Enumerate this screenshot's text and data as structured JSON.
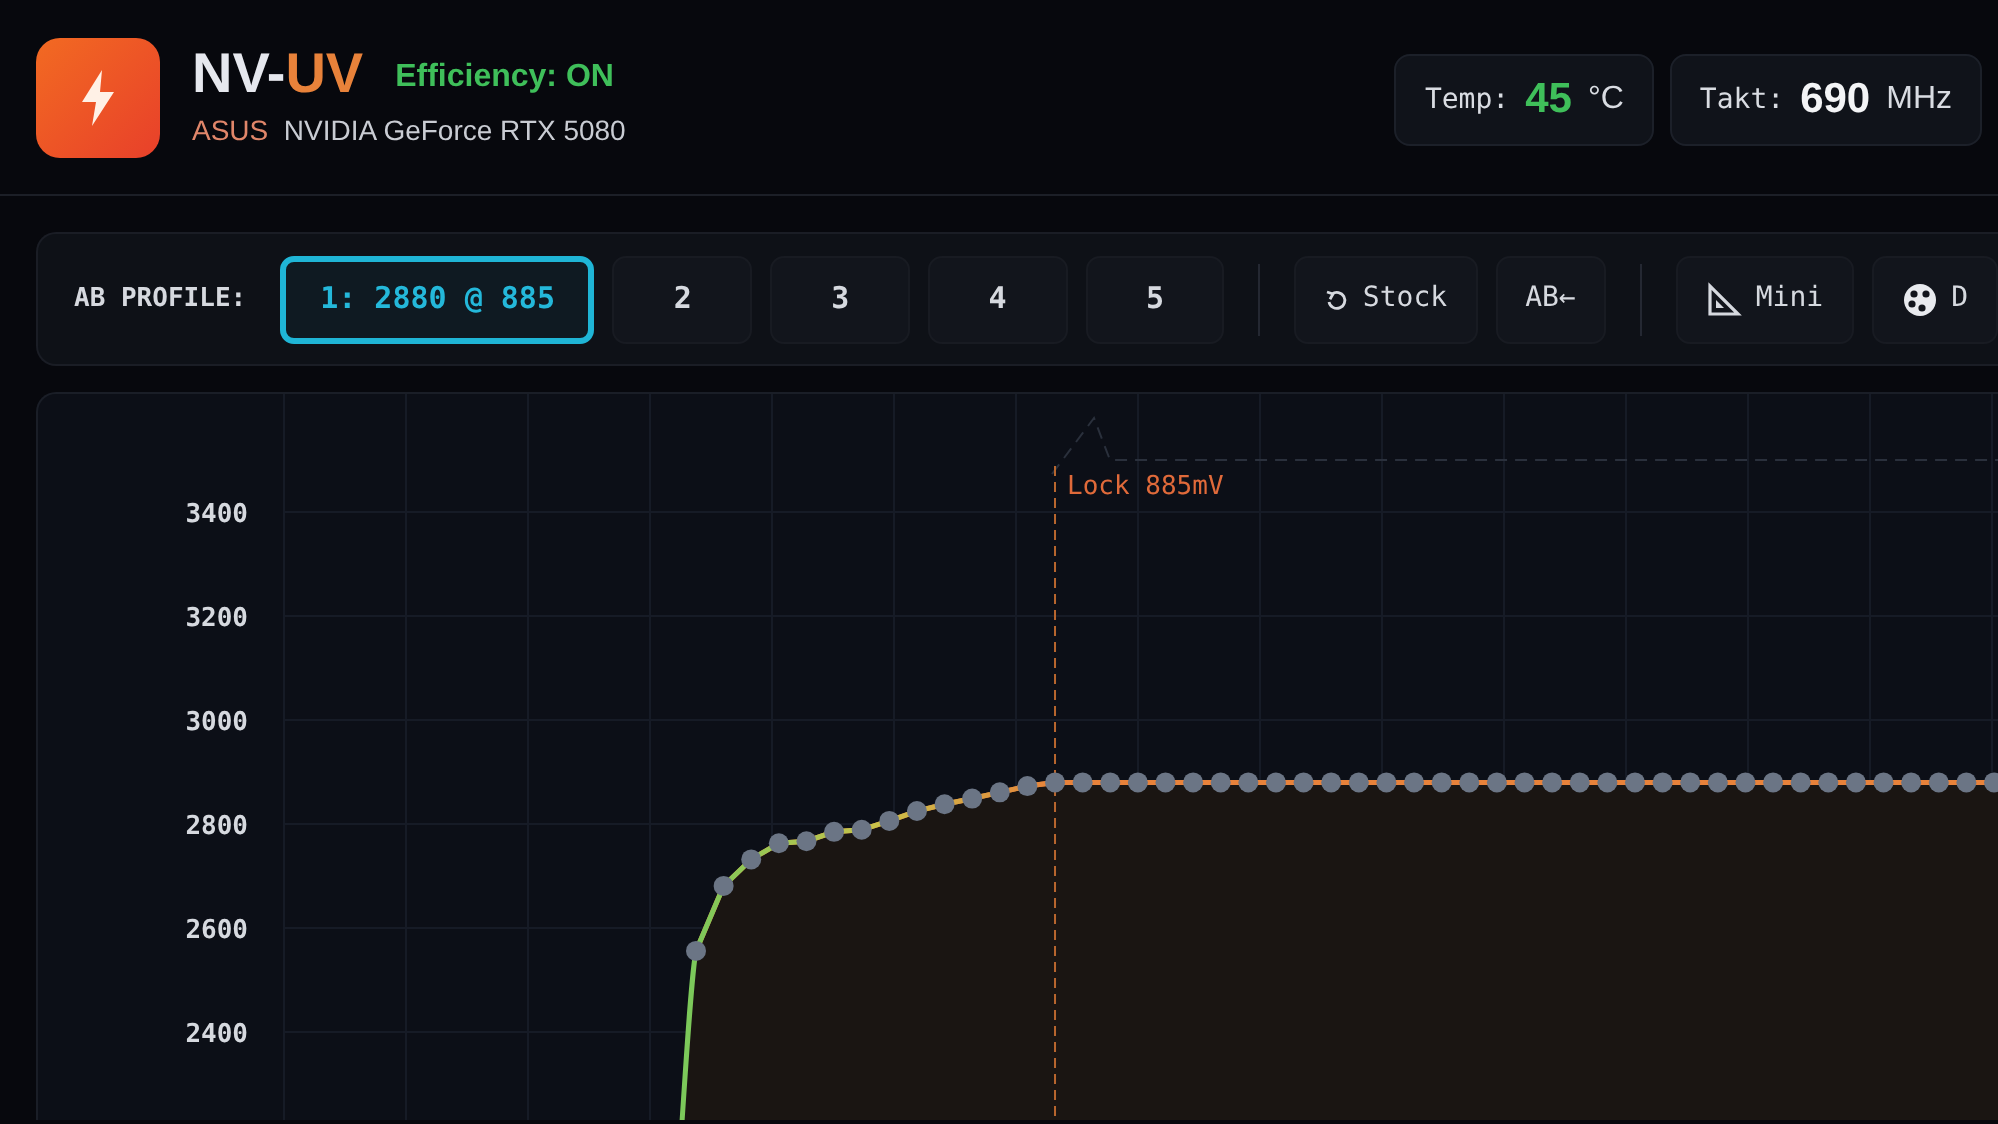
{
  "header": {
    "title": {
      "main": "NV-",
      "accent": "UV"
    },
    "efficiency": {
      "label": "Efficiency: ON",
      "on": true
    },
    "vendor": "ASUS",
    "gpu": "NVIDIA GeForce RTX 5080"
  },
  "stats": [
    {
      "label": "Temp:",
      "value": "45",
      "unit": "°C",
      "kind": "temp"
    },
    {
      "label": "Takt:",
      "value": "690",
      "unit": "MHz",
      "kind": "clock"
    }
  ],
  "toolbar": {
    "label": "AB PROFILE:",
    "profiles": [
      {
        "label": "1: 2880 @ 885",
        "selected": true
      },
      {
        "label": "2",
        "selected": false
      },
      {
        "label": "3",
        "selected": false
      },
      {
        "label": "4",
        "selected": false
      },
      {
        "label": "5",
        "selected": false
      }
    ],
    "actions": [
      {
        "label": "Stock",
        "kind": "reset",
        "separated": true
      },
      {
        "label": "AB←",
        "kind": "plain",
        "separated": false
      },
      {
        "label": "Mini",
        "kind": "ruler",
        "separated": true
      },
      {
        "label": "D",
        "kind": "palette",
        "separated": false
      }
    ]
  },
  "curve": {
    "chart_data": {
      "type": "line",
      "grid": true,
      "ylim": [
        2227,
        3627
      ],
      "yticks": [
        2400,
        2600,
        2800,
        3000,
        3200,
        3400
      ],
      "categories": [
        null,
        null,
        null,
        null,
        null,
        null,
        null,
        null,
        null,
        null,
        null,
        null,
        null,
        null,
        null,
        null,
        null,
        null,
        null,
        null,
        null,
        null,
        null,
        null,
        null,
        null,
        null,
        null,
        null,
        null,
        null,
        null,
        null,
        null,
        null,
        null,
        null,
        null,
        null,
        null,
        null,
        null,
        null,
        null,
        null,
        null,
        null,
        null
      ],
      "series": [
        {
          "color": "#e8823a",
          "marker": "o",
          "values": [
            2556,
            2681,
            2732,
            2763,
            2767,
            2785,
            2789,
            2806,
            2825,
            2838,
            2849,
            2861,
            2873,
            2880,
            2880,
            2880,
            2880,
            2880,
            2880,
            2880,
            2880,
            2880,
            2880,
            2880,
            2880,
            2880,
            2880,
            2880,
            2880,
            2880,
            2880,
            2880,
            2880,
            2880,
            2880,
            2880,
            2880,
            2880,
            2880,
            2880,
            2880,
            2880,
            2880,
            2880,
            2880,
            2880,
            2880,
            2880
          ]
        }
      ],
      "annotations": [
        {
          "text": "Lock 885mV"
        }
      ]
    }
  }
}
